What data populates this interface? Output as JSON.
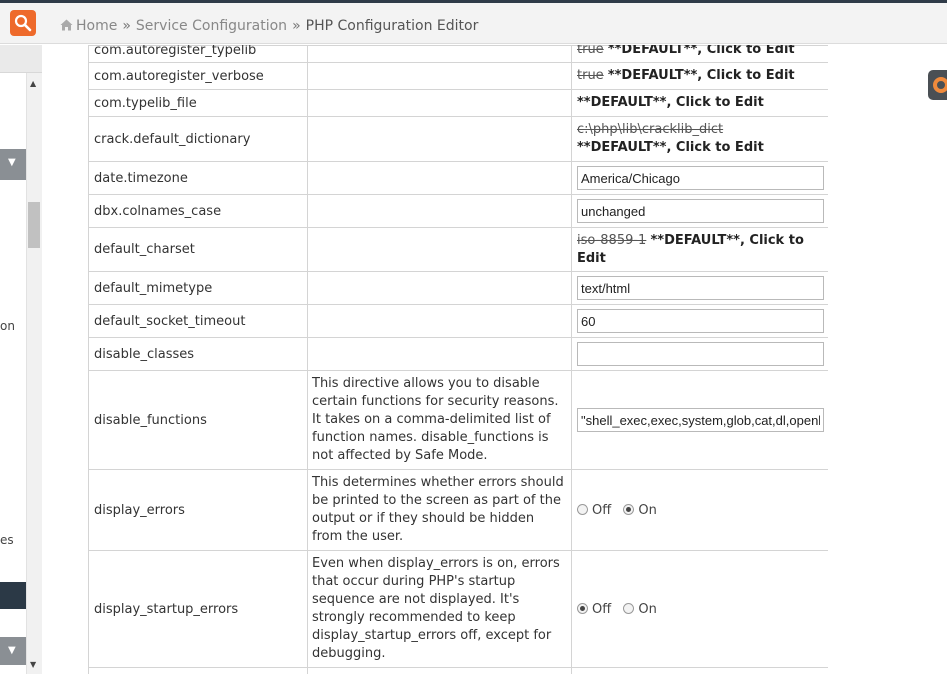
{
  "header": {
    "search_icon": "search-icon",
    "breadcrumb": {
      "home": "Home",
      "section": "Service Configuration",
      "current": "PHP Configuration Editor",
      "separator": "»"
    }
  },
  "sidebar": {
    "text_fragment_1": "on",
    "text_fragment_2": "es"
  },
  "default_link": "**DEFAULT**, Click to Edit",
  "rows": {
    "com_autoregister_typelib": {
      "name": "com.autoregister_typelib",
      "old": "true",
      "edit": "**DEFAULT**, Click to Edit"
    },
    "com_autoregister_verbose": {
      "name": "com.autoregister_verbose",
      "old": "true",
      "edit": "**DEFAULT**, Click to Edit"
    },
    "com_typelib_file": {
      "name": "com.typelib_file",
      "edit": "**DEFAULT**, Click to Edit"
    },
    "crack_default_dictionary": {
      "name": "crack.default_dictionary",
      "old": "c:\\php\\lib\\cracklib_dict",
      "edit": "**DEFAULT**, Click to Edit"
    },
    "date_timezone": {
      "name": "date.timezone",
      "value": "America/Chicago"
    },
    "dbx_colnames_case": {
      "name": "dbx.colnames_case",
      "value": "unchanged"
    },
    "default_charset": {
      "name": "default_charset",
      "old": "iso-8859-1",
      "edit": "**DEFAULT**, Click to Edit"
    },
    "default_mimetype": {
      "name": "default_mimetype",
      "value": "text/html"
    },
    "default_socket_timeout": {
      "name": "default_socket_timeout",
      "value": "60"
    },
    "disable_classes": {
      "name": "disable_classes",
      "value": ""
    },
    "disable_functions": {
      "name": "disable_functions",
      "description": "This directive allows you to disable certain functions for security reasons. It takes on a comma-delimited list of function names. disable_functions is not affected by Safe Mode.",
      "value": "\"shell_exec,exec,system,glob,cat,dl,openbasedir,popen,proc_close,proc_get_status,proc_nice,proc_open,escapeshellcmd,escapeshellarg,show_source,posix_mkfifo,mysql_list_dbs,get_current_user,getmyid,leak,pclose\""
    },
    "display_errors": {
      "name": "display_errors",
      "description": "This determines whether errors should be printed to the screen as part of the output or if they should be hidden from the user.",
      "off_label": "Off",
      "on_label": "On",
      "selected": "On"
    },
    "display_startup_errors": {
      "name": "display_startup_errors",
      "description": "Even when display_errors is on, errors that occur during PHP's startup sequence are not displayed. It's strongly recommended to keep display_startup_errors off, except for debugging.",
      "off_label": "Off",
      "on_label": "On",
      "selected": "Off"
    }
  },
  "colors": {
    "accent": "#ee6a2b",
    "topstrip": "#2f3b48",
    "border": "#d4d4d4"
  }
}
